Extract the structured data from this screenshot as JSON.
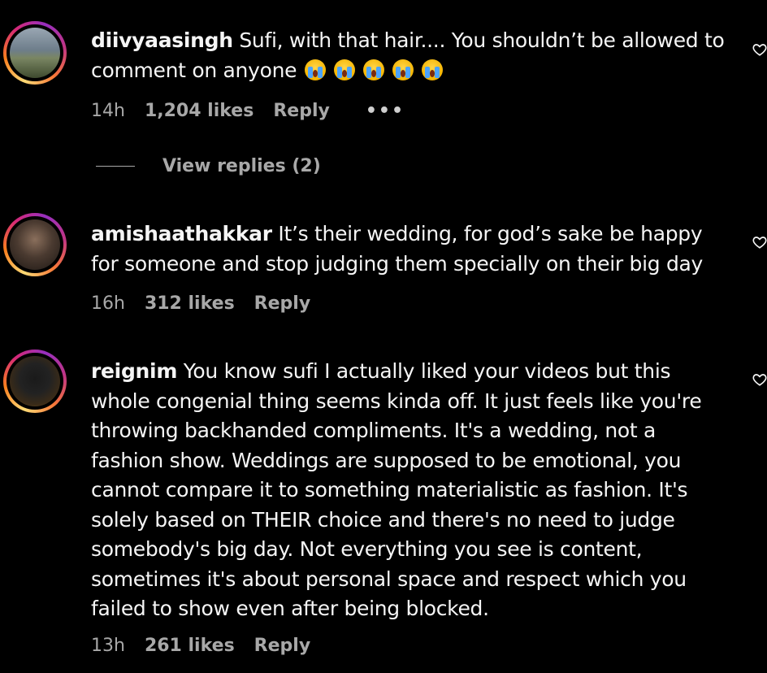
{
  "comments": [
    {
      "username": "diivyaasingh",
      "text_line1": " Sufi, with that hair.... You shouldn’t be allowed to",
      "text_line2": "comment on anyone",
      "emoji": [
        "loudly-crying-face",
        "loudly-crying-face",
        "loudly-crying-face",
        "loudly-crying-face",
        "loudly-crying-face"
      ],
      "time": "14h",
      "likes": "1,204 likes",
      "reply": "Reply",
      "more": "•••"
    },
    {
      "username": "amishaathakkar",
      "text": " It’s their wedding, for god’s sake be happy for someone and stop judging them specially on their big day",
      "time": "16h",
      "likes": "312 likes",
      "reply": "Reply"
    },
    {
      "username": "reignim",
      "text": " You know sufi I actually liked your videos but this whole congenial thing seems kinda off. It just feels like you're throwing backhanded compliments. It's a wedding, not a fashion show. Weddings are supposed to be emotional, you cannot compare it to something materialistic as fashion. It's solely based on THEIR choice and there's no need to judge somebody's big day. Not everything you see is content, sometimes it's about personal space and respect which you failed to show even after being blocked.",
      "time": "13h",
      "likes": "261 likes",
      "reply": "Reply"
    }
  ],
  "view_replies": "View replies (2)",
  "icons": {
    "like": "heart-outline-icon",
    "avatar_ring_colors": [
      "#feda75",
      "#fa7e1e",
      "#d62976",
      "#962fbf"
    ]
  }
}
